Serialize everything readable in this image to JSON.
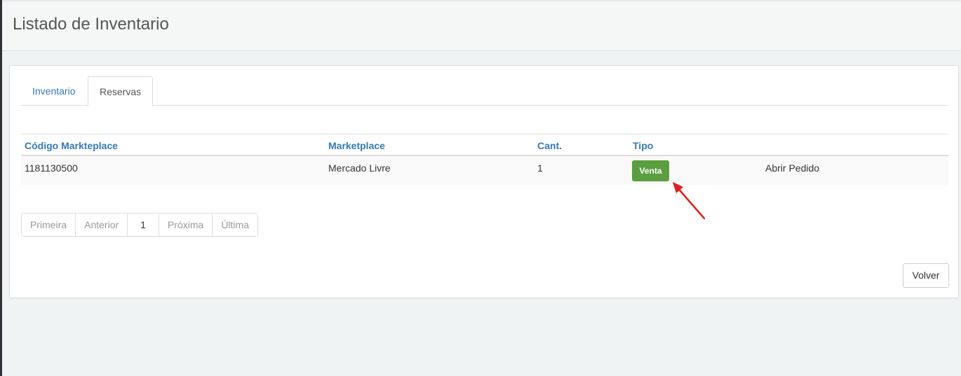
{
  "page": {
    "title": "Listado de Inventario"
  },
  "tabs": [
    {
      "label": "Inventario",
      "active": false
    },
    {
      "label": "Reservas",
      "active": true
    }
  ],
  "table": {
    "headers": [
      "Código Markteplace",
      "Marketplace",
      "Cant.",
      "Tipo"
    ],
    "rows": [
      {
        "codigo": "1181130500",
        "marketplace": "Mercado Livre",
        "cant": "1",
        "tipo": "Venta",
        "action": "Abrir Pedido"
      }
    ]
  },
  "pagination": {
    "first": "Primeira",
    "prev": "Anterior",
    "current": "1",
    "next": "Próxima",
    "last": "Última"
  },
  "buttons": {
    "back": "Volver"
  },
  "colors": {
    "accent": "#337ab7",
    "success": "#5a9e3f",
    "annotation_arrow": "#e0201b"
  }
}
